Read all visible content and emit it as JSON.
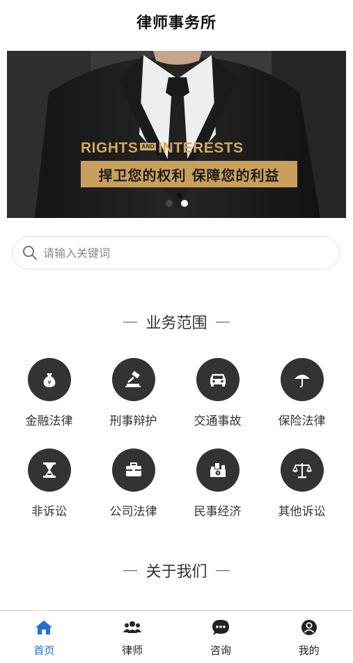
{
  "header": {
    "title": "律师事务所"
  },
  "banner": {
    "tag_en_left": "RIGHTS",
    "tag_en_and": "AND",
    "tag_en_right": "INTERESTS",
    "tag_cn": "捍卫您的权利 保障您的利益",
    "slide_count": 2,
    "active_slide": 1
  },
  "search": {
    "placeholder": "请输入关键词",
    "value": ""
  },
  "services": {
    "title": "业务范围",
    "items": [
      {
        "label": "金融法律",
        "icon": "money-bag-icon"
      },
      {
        "label": "刑事辩护",
        "icon": "gavel-icon"
      },
      {
        "label": "交通事故",
        "icon": "car-icon"
      },
      {
        "label": "保险法律",
        "icon": "umbrella-icon"
      },
      {
        "label": "非诉讼",
        "icon": "hourglass-icon"
      },
      {
        "label": "公司法律",
        "icon": "briefcase-icon"
      },
      {
        "label": "民事经济",
        "icon": "finance-building-icon"
      },
      {
        "label": "其他诉讼",
        "icon": "scales-icon"
      }
    ]
  },
  "about": {
    "title": "关于我们"
  },
  "tabbar": {
    "items": [
      {
        "label": "首页",
        "icon": "home-icon",
        "active": true
      },
      {
        "label": "律师",
        "icon": "people-icon",
        "active": false
      },
      {
        "label": "咨询",
        "icon": "chat-icon",
        "active": false
      },
      {
        "label": "我的",
        "icon": "user-icon",
        "active": false
      }
    ]
  },
  "colors": {
    "accent": "#1f6fd6",
    "icon_bg": "#333333",
    "banner_gold": "#c9a05b"
  }
}
